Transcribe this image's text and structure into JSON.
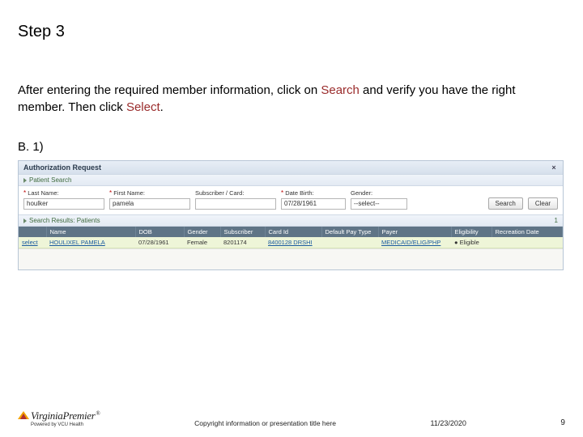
{
  "title": "Step 3",
  "instruction": {
    "pre1": "After entering the required member information, click on ",
    "kw1": "Search",
    "mid": " and verify you have the right member. Then click ",
    "kw2": "Select",
    "post": "."
  },
  "subLabel": "B. 1)",
  "panel": {
    "title": "Authorization Request",
    "closeGlyph": "×",
    "searchSection": "Patient Search",
    "fields": {
      "lastName": {
        "label": "Last Name:",
        "value": "houlker"
      },
      "firstName": {
        "label": "First Name:",
        "value": "pamela"
      },
      "subscriber": {
        "label": "Subscriber / Card:",
        "value": ""
      },
      "dob": {
        "label": "Date Birth:",
        "value": "07/28/1961"
      },
      "gender": {
        "label": "Gender:",
        "value": "--select--"
      }
    },
    "buttons": {
      "search": "Search",
      "clear": "Clear"
    },
    "resultsSection": "Search Results: Patients",
    "resultsCount": "1",
    "columns": [
      "",
      "Name",
      "DOB",
      "Gender",
      "Subscriber",
      "Card Id",
      "Default Pay Type",
      "Payer",
      "Eligibility",
      "Recreation Date"
    ],
    "row": {
      "select": "select",
      "name": "HOULIXEL PAMELA",
      "dob": "07/28/1961",
      "gender": "Female",
      "subscriber": "8201174",
      "cardId": "8400128 DRSHI",
      "payType": "",
      "payer": "MEDICAID/ELIG/PHP",
      "eligibility": "Eligible",
      "recDate": ""
    }
  },
  "footer": {
    "brand1": "Virginia",
    "brand2": "Premier",
    "regmark": "®",
    "tagline": "Powered by VCU Health",
    "copyright": "Copyright information or presentation title here",
    "date": "11/23/2020",
    "page": "9"
  }
}
